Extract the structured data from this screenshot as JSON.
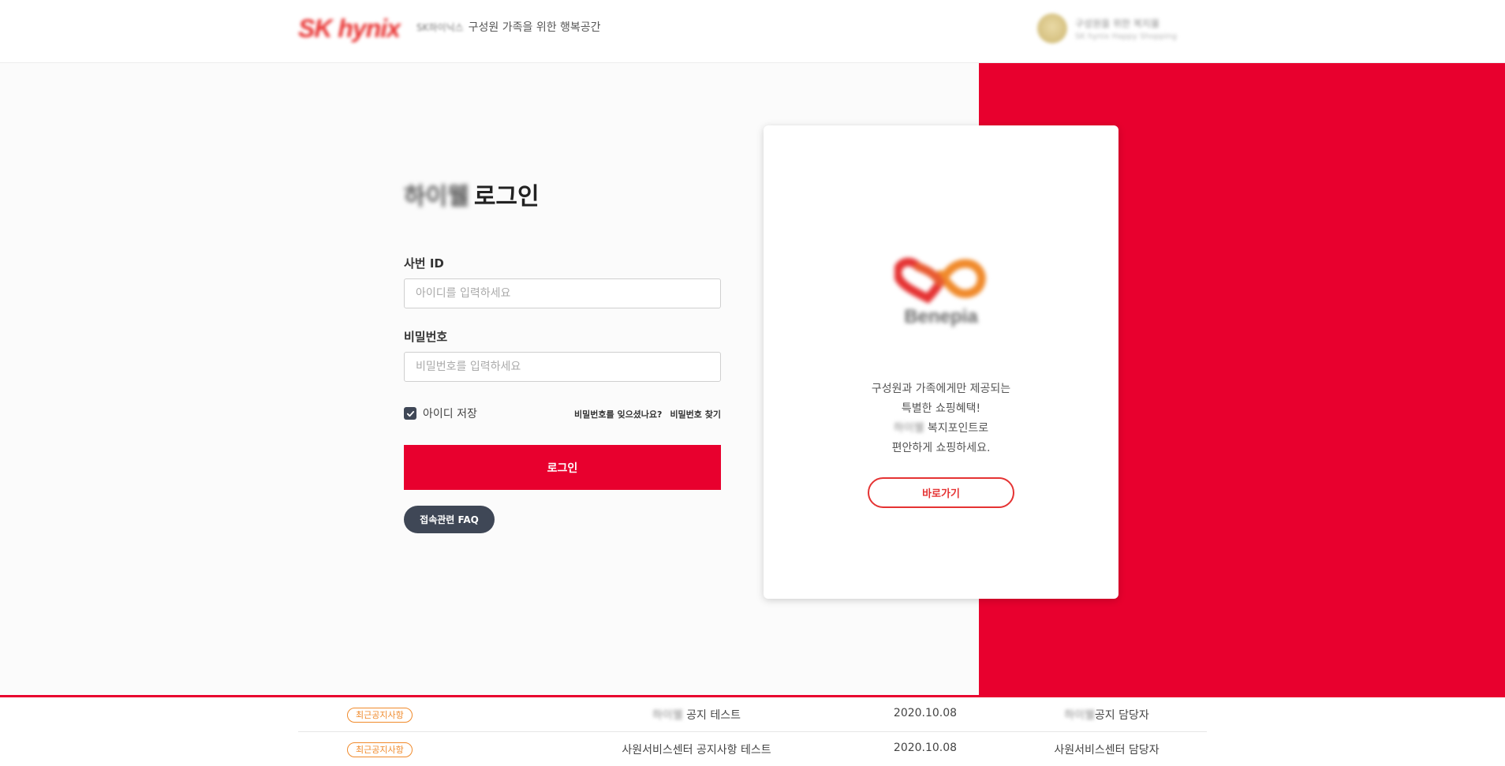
{
  "header": {
    "brand_logo": "SK hynix",
    "brand_sub": "SK하이닉스",
    "tagline": "구성원 가족을 위한 행복공간",
    "user_line1": "구성원을 위한 복지몰",
    "user_line1_accent": "복지몰",
    "user_line2": "SK hynix Happy Shopping"
  },
  "login": {
    "title_prefix": "하이웰",
    "title": "로그인",
    "id_label": "사번 ID",
    "id_placeholder": "아이디를 입력하세요",
    "id_value": "",
    "pw_label": "비밀번호",
    "pw_placeholder": "비밀번호를 입력하세요",
    "pw_value": "",
    "remember_label": "아이디 저장",
    "remember_checked": true,
    "forgot_question": "비밀번호를 잊으셨나요?",
    "forgot_link": "비밀번호 찾기",
    "login_button": "로그인",
    "faq_button": "접속관련 FAQ"
  },
  "card": {
    "logo_text": "Benepia",
    "line1": "구성원과 가족에게만 제공되는",
    "line2": "특별한 쇼핑혜택!",
    "line3_blur": "하이웰",
    "line3": "복지포인트로",
    "line4": "편안하게 쇼핑하세요.",
    "button": "바로가기"
  },
  "notices": [
    {
      "badge": "최근공지사항",
      "title_blur": "하이웰",
      "title": "공지 테스트",
      "date": "2020.10.08",
      "author_blur": "하이웰",
      "author": "공지 담당자"
    },
    {
      "badge": "최근공지사항",
      "title_blur": "",
      "title": "사원서비스센터 공지사항 테스트",
      "date": "2020.10.08",
      "author_blur": "",
      "author": "사원서비스센터 담당자"
    }
  ],
  "colors": {
    "brand_red": "#e8002e",
    "dark_button": "#3f4756",
    "badge_orange": "#f08a2b"
  }
}
